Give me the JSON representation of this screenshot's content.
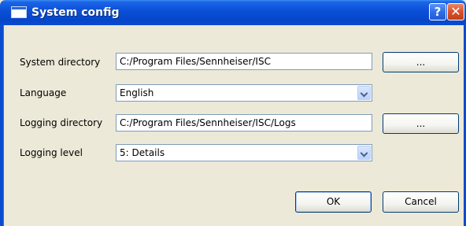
{
  "window": {
    "title": "System config",
    "help_label": "?",
    "close_label": "✕"
  },
  "form": {
    "system_directory": {
      "label": "System directory",
      "value": "C:/Program Files/Sennheiser/ISC",
      "browse_label": "..."
    },
    "language": {
      "label": "Language",
      "selected": "English"
    },
    "logging_directory": {
      "label": "Logging directory",
      "value": "C:/Program Files/Sennheiser/ISC/Logs",
      "browse_label": "..."
    },
    "logging_level": {
      "label": "Logging level",
      "selected": "5: Details"
    }
  },
  "buttons": {
    "ok": "OK",
    "cancel": "Cancel"
  }
}
